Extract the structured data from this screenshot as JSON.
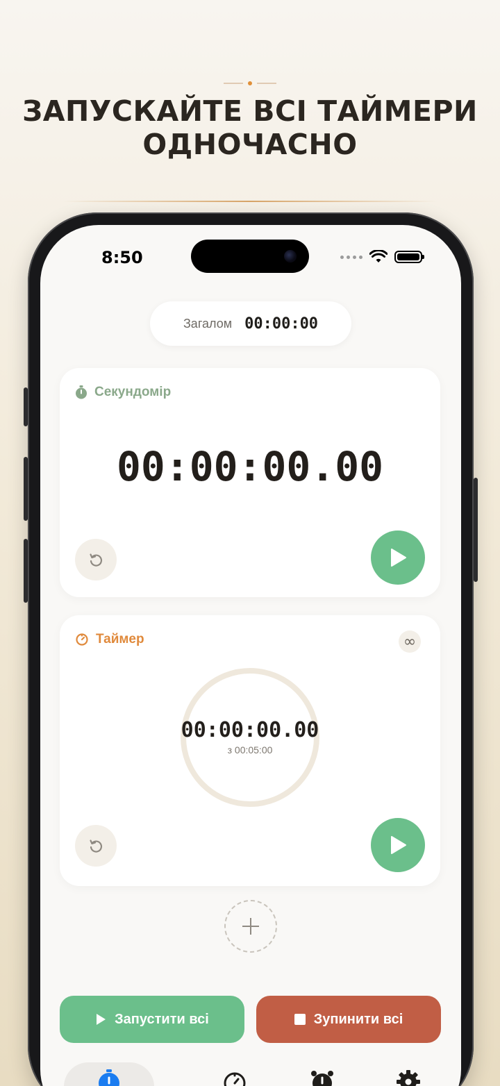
{
  "headline": {
    "line1": "ЗАПУСКАЙТЕ ВСІ ТАЙМЕРИ",
    "line2": "ОДНОЧАСНО"
  },
  "status_bar": {
    "time": "8:50"
  },
  "total": {
    "label": "Загалом",
    "value": "00:00:00"
  },
  "stopwatch_card": {
    "title": "Секундомір",
    "time": "00:00:00.00",
    "accent_color": "#8aa88a"
  },
  "timer_card": {
    "title": "Таймер",
    "time": "00:00:00.00",
    "of_label": "з 00:05:00",
    "repeat_symbol": "∞",
    "accent_color": "#e08a3c",
    "progress": 0
  },
  "actions": {
    "start_all": "Запустити всі",
    "stop_all": "Зупинити всі"
  },
  "tabs": [
    {
      "icon": "stopwatch-icon",
      "active": true
    },
    {
      "icon": "timer-icon",
      "active": false
    },
    {
      "icon": "alarm-clock-icon",
      "active": false
    },
    {
      "icon": "gear-icon",
      "active": false
    }
  ],
  "colors": {
    "play_green": "#6bbf8b",
    "stop_red": "#c15e45",
    "active_tab_blue": "#1a7cf0"
  }
}
